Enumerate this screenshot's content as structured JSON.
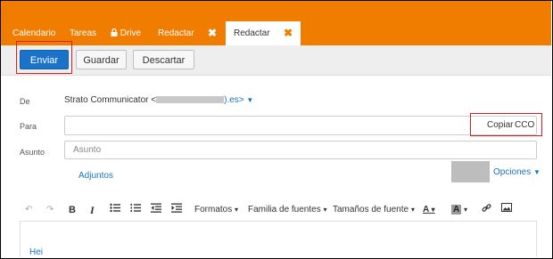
{
  "tabs": [
    {
      "label": "Calendario"
    },
    {
      "label": "Tareas"
    },
    {
      "label": "Drive",
      "icon": "lock-icon"
    },
    {
      "label": "Redactar",
      "close": "✖"
    },
    {
      "label": "Redactar",
      "close": "✖",
      "active": true
    }
  ],
  "toolbar": {
    "send_label": "Enviar",
    "save_label": "Guardar",
    "discard_label": "Descartar"
  },
  "form": {
    "from_label": "De",
    "from_name": "Strato Communicator <",
    "from_suffix": ").es>",
    "to_label": "Para",
    "copy_label": "Copiar",
    "bcc_label": "CCO",
    "subject_label": "Asunto",
    "subject_placeholder": "Asunto",
    "attachments_label": "Adjuntos",
    "options_label": "Opciones"
  },
  "editor_toolbar": {
    "formats_label": "Formatos",
    "font_family_label": "Familia de fuentes",
    "font_size_label": "Tamaños de fuente"
  },
  "editor": {
    "body_text": "Hei"
  },
  "colors": {
    "accent": "#f07c00",
    "primary": "#1a73c8",
    "highlight": "#e01b1b"
  }
}
